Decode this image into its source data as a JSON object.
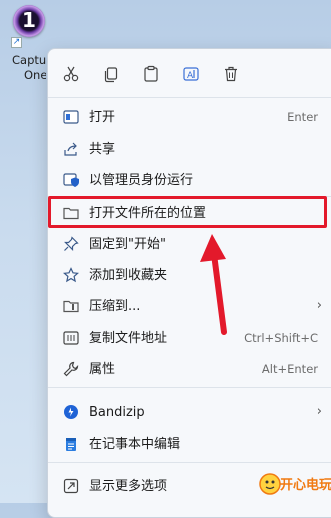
{
  "desktop": {
    "shortcut": {
      "name_line1": "Captu",
      "name_line2": "One"
    }
  },
  "toolbar": {
    "buttons": [
      {
        "icon": "cut-icon"
      },
      {
        "icon": "copy-icon"
      },
      {
        "icon": "paste-icon"
      },
      {
        "icon": "rename-icon"
      },
      {
        "icon": "delete-icon"
      }
    ]
  },
  "menu": {
    "items": [
      {
        "label": "打开",
        "shortcut": "Enter",
        "icon": "open-app-icon"
      },
      {
        "label": "共享",
        "shortcut": "",
        "icon": "share-icon"
      },
      {
        "label": "以管理员身份运行",
        "shortcut": "",
        "icon": "shield-icon"
      },
      {
        "label": "打开文件所在的位置",
        "shortcut": "",
        "icon": "folder-icon",
        "highlighted": true
      },
      {
        "label": "固定到\"开始\"",
        "shortcut": "",
        "icon": "pin-icon"
      },
      {
        "label": "添加到收藏夹",
        "shortcut": "",
        "icon": "star-icon"
      },
      {
        "label": "压缩到...",
        "shortcut": "",
        "icon": "zip-icon",
        "submenu": true
      },
      {
        "label": "复制文件地址",
        "shortcut": "Ctrl+Shift+C",
        "icon": "copy-path-icon"
      },
      {
        "label": "属性",
        "shortcut": "Alt+Enter",
        "icon": "wrench-icon"
      },
      {
        "label": "Bandizip",
        "shortcut": "",
        "icon": "bandizip-icon",
        "submenu": true
      },
      {
        "label": "在记事本中编辑",
        "shortcut": "",
        "icon": "notepad-icon"
      },
      {
        "label": "显示更多选项",
        "shortcut": "",
        "icon": "more-options-icon"
      }
    ],
    "submenu_chevron": "›"
  },
  "annotation": {
    "arrow_color": "#e3192b",
    "box_color": "#e3192b"
  },
  "watermark": {
    "text": "开心电玩"
  }
}
